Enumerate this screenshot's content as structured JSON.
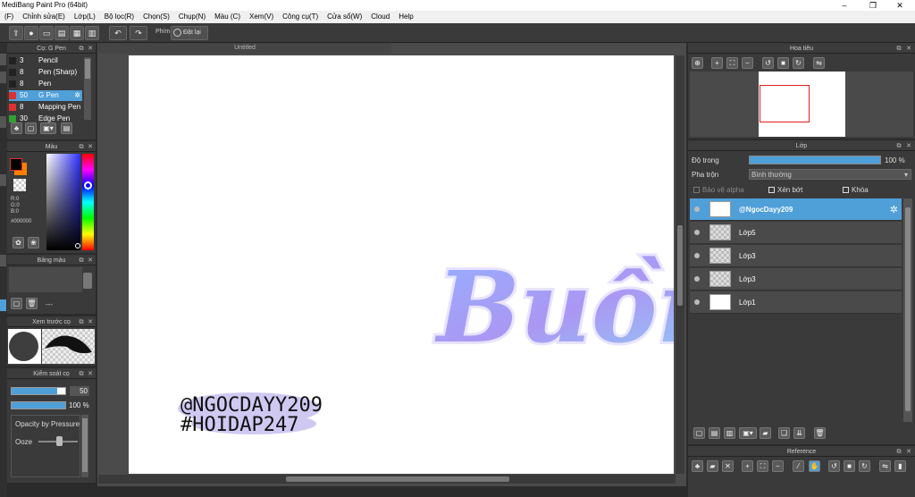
{
  "window": {
    "title": "MediBang Paint Pro (64bit)",
    "min": "–",
    "max": "❐",
    "close": "✕"
  },
  "menu": [
    "(F)",
    "Chỉnh sửa(E)",
    "Lớp(L)",
    "Bộ lọc(R)",
    "Chọn(S)",
    "Chụp(N)",
    "Màu (C)",
    "Xem(V)",
    "Công cụ(T)",
    "Cửa sổ(W)",
    "Cloud",
    "Help"
  ],
  "toolbar": {
    "undo": "↶",
    "redo": "↷",
    "shortcut_label": "Phím",
    "reset_label": "Đặt lại"
  },
  "brush_panel": {
    "title": "Cọ: G Pen",
    "items": [
      {
        "size": "3",
        "name": "Pencil",
        "color": "#222222"
      },
      {
        "size": "8",
        "name": "Pen (Sharp)",
        "color": "#222222"
      },
      {
        "size": "8",
        "name": "Pen",
        "color": "#222222"
      },
      {
        "size": "50",
        "name": "G Pen",
        "color": "#e03030",
        "selected": true
      },
      {
        "size": "8",
        "name": "Mapping Pen",
        "color": "#e03030"
      },
      {
        "size": "30",
        "name": "Edge Pen",
        "color": "#30a030"
      }
    ]
  },
  "color_panel": {
    "title": "Màu",
    "r": "R:0",
    "g": "G:0",
    "b": "B:0",
    "hex": "#000000",
    "fg": "#000000",
    "bg": "#ff7f00"
  },
  "palette_panel": {
    "title": "Bảng màu",
    "value": "---"
  },
  "preview_panel": {
    "title": "Xem trước cọ"
  },
  "brush_control": {
    "title": "Kiểm soát cọ",
    "size": "50",
    "opacity": "100 %",
    "size_frac": 0.85,
    "opacity_frac": 1.0,
    "pressure_label": "Opacity by Pressure",
    "ooze_label": "Ooze"
  },
  "canvas": {
    "tab_title": "Untitled",
    "art_main": "Buồn",
    "watermark_line1": "@NGOCDAYY209",
    "watermark_line2": "#HOIDAP247"
  },
  "navigator": {
    "title": "Hoa tiêu"
  },
  "layer_panel": {
    "title": "Lớp",
    "opacity_label": "Độ trong",
    "opacity_value": "100 %",
    "opacity_frac": 1.0,
    "blend_label": "Pha trộn",
    "blend_value": "Bình thường",
    "protect_alpha": "Bảo vệ alpha",
    "clipping": "Xén bớt",
    "lock": "Khóa",
    "layers": [
      {
        "name": "@NgocDayy209",
        "selected": true,
        "thumb": "white"
      },
      {
        "name": "Lớp5",
        "thumb": "checker"
      },
      {
        "name": "Lớp3",
        "thumb": "checker"
      },
      {
        "name": "Lớp3",
        "thumb": "checker"
      },
      {
        "name": "Lớp1",
        "thumb": "white"
      }
    ]
  },
  "reference_panel": {
    "title": "Reference"
  },
  "colors": {
    "accent": "#4f9fd8",
    "canvas_bg": "#ffffff",
    "panel": "#3a3a3a"
  }
}
